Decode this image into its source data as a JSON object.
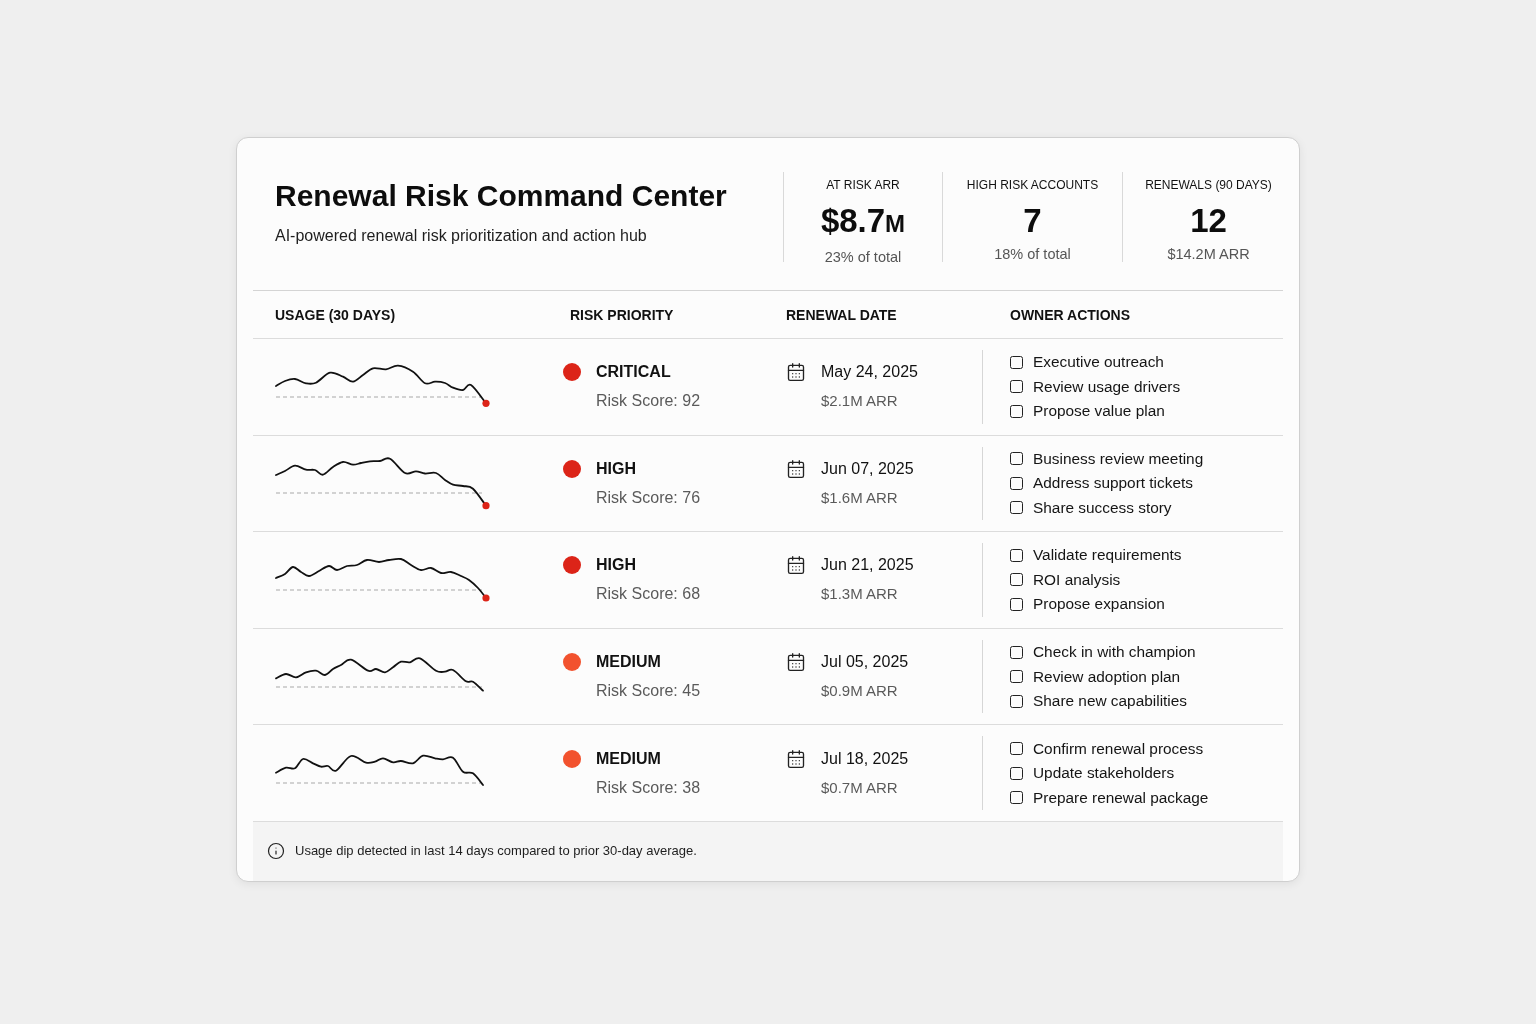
{
  "header": {
    "title": "Renewal Risk Command Center",
    "subtitle": "AI-powered renewal risk prioritization and action hub"
  },
  "stats": [
    {
      "label": "AT RISK ARR",
      "value": "$8.7",
      "unit": "M",
      "note": "23% of total"
    },
    {
      "label": "HIGH RISK ACCOUNTS",
      "value": "7",
      "note": "18% of total"
    },
    {
      "label": "RENEWALS (90 DAYS)",
      "value": "12",
      "note": "$14.2M ARR"
    }
  ],
  "table": {
    "columns": [
      "USAGE (30 DAYS)",
      "RISK PRIORITY",
      "RENEWAL DATE",
      "OWNER ACTIONS"
    ],
    "rows": [
      {
        "usage_dip": true,
        "risk": {
          "label": "CRITICAL",
          "color": "#dc2418",
          "score": "Risk Score: 92"
        },
        "renewal": {
          "date": "May 24, 2025",
          "arr": "$2.1M ARR"
        },
        "actions": [
          {
            "label": "Executive outreach",
            "checked": false
          },
          {
            "label": "Review usage drivers",
            "checked": false
          },
          {
            "label": "Propose value plan",
            "checked": false
          }
        ]
      },
      {
        "usage_dip": true,
        "risk": {
          "label": "HIGH",
          "color": "#dc2418",
          "score": "Risk Score: 76"
        },
        "renewal": {
          "date": "Jun 07, 2025",
          "arr": "$1.6M ARR"
        },
        "actions": [
          {
            "label": "Business review meeting",
            "checked": false
          },
          {
            "label": "Address support tickets",
            "checked": false
          },
          {
            "label": "Share success story",
            "checked": false
          }
        ]
      },
      {
        "usage_dip": true,
        "risk": {
          "label": "HIGH",
          "color": "#dc2418",
          "score": "Risk Score: 68"
        },
        "renewal": {
          "date": "Jun 21, 2025",
          "arr": "$1.3M ARR"
        },
        "actions": [
          {
            "label": "Validate requirements",
            "checked": false
          },
          {
            "label": "ROI analysis",
            "checked": false
          },
          {
            "label": "Propose expansion",
            "checked": false
          }
        ]
      },
      {
        "usage_dip": false,
        "risk": {
          "label": "MEDIUM",
          "color": "#f2522e",
          "score": "Risk Score: 45"
        },
        "renewal": {
          "date": "Jul 05, 2025",
          "arr": "$0.9M ARR"
        },
        "actions": [
          {
            "label": "Check in with champion",
            "checked": false
          },
          {
            "label": "Review adoption plan",
            "checked": false
          },
          {
            "label": "Share new capabilities",
            "checked": false
          }
        ]
      },
      {
        "usage_dip": false,
        "risk": {
          "label": "MEDIUM",
          "color": "#f2522e",
          "score": "Risk Score: 38"
        },
        "renewal": {
          "date": "Jul 18, 2025",
          "arr": "$0.7M ARR"
        },
        "actions": [
          {
            "label": "Confirm renewal process",
            "checked": false
          },
          {
            "label": "Update stakeholders",
            "checked": false
          },
          {
            "label": "Prepare renewal package",
            "checked": false
          }
        ]
      }
    ]
  },
  "footer": {
    "note": "Usage dip detected in last 14 days compared to prior 30-day average."
  }
}
